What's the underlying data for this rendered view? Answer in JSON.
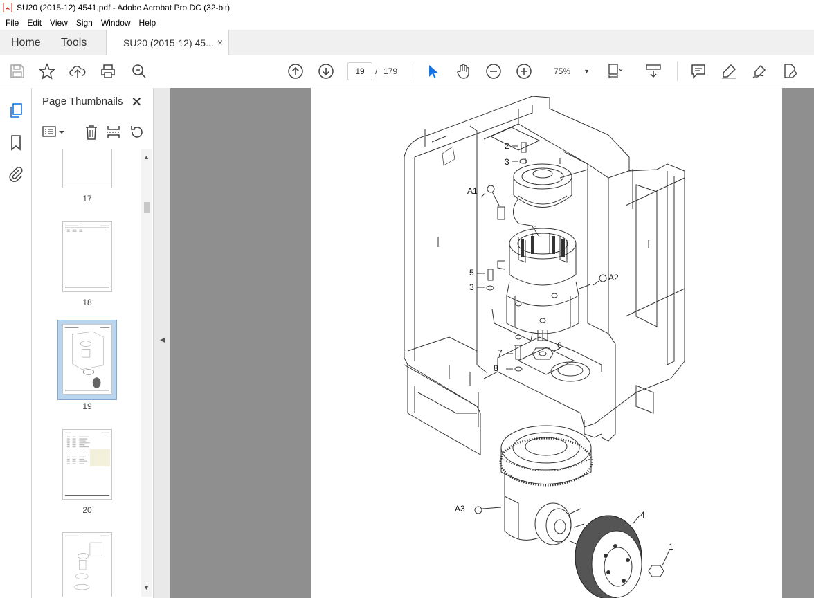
{
  "window": {
    "title": "SU20 (2015-12) 4541.pdf - Adobe Acrobat Pro DC (32-bit)"
  },
  "menu": [
    "File",
    "Edit",
    "View",
    "Sign",
    "Window",
    "Help"
  ],
  "tabs": {
    "home": "Home",
    "tools": "Tools",
    "document": "SU20 (2015-12) 45...",
    "close_glyph": "×"
  },
  "toolbar": {
    "current_page": "19",
    "page_separator": "/",
    "total_pages": "179",
    "zoom": "75%",
    "icons": [
      "save-icon",
      "star-icon",
      "upload-icon",
      "print-icon",
      "search-icon",
      "page-up-icon",
      "page-down-icon",
      "select-cursor-icon",
      "hand-icon",
      "zoom-out-icon",
      "zoom-in-icon",
      "page-fit-icon",
      "scroll-mode-icon",
      "comment-icon",
      "highlight-icon",
      "sign-icon",
      "edit-pdf-icon"
    ]
  },
  "panel": {
    "title": "Page Thumbnails",
    "close_glyph": "✕",
    "thumbnails": [
      {
        "label": "17",
        "selected": false
      },
      {
        "label": "18",
        "selected": false
      },
      {
        "label": "19",
        "selected": true
      },
      {
        "label": "20",
        "selected": false
      },
      {
        "label": "",
        "selected": false
      }
    ]
  },
  "drawing": {
    "callouts": [
      "2",
      "3",
      "A1",
      "5",
      "3",
      "A2",
      "7",
      "6",
      "8",
      "A3",
      "4",
      "1"
    ]
  },
  "colors": {
    "accent": "#1473e6",
    "selected_thumb_bg": "#b9d6ee",
    "canvas": "#8f8f8f",
    "pdf_icon": "#d9261c"
  }
}
